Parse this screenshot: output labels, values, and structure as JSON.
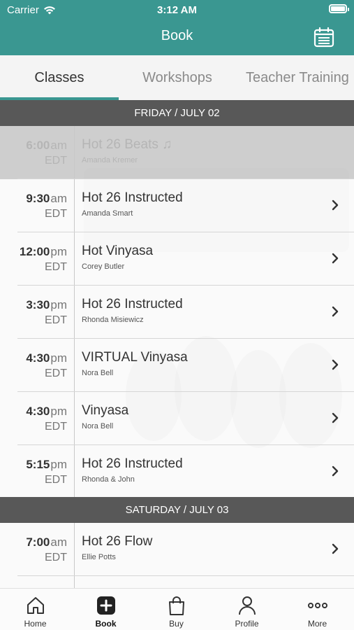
{
  "status_bar": {
    "carrier": "Carrier",
    "time": "3:12 AM"
  },
  "header": {
    "title": "Book",
    "icon": "calendar-icon"
  },
  "tabs": [
    {
      "label": "Classes",
      "active": true
    },
    {
      "label": "Workshops",
      "active": false
    },
    {
      "label": "Teacher Training",
      "active": false
    }
  ],
  "days": [
    {
      "label": "FRIDAY / JULY 02",
      "classes": [
        {
          "hour": "6:00",
          "ampm": "am",
          "tz": "EDT",
          "name": "Hot 26 Beats ♫",
          "teacher": "Amanda Kremer",
          "past": true
        },
        {
          "hour": "9:30",
          "ampm": "am",
          "tz": "EDT",
          "name": "Hot 26 Instructed",
          "teacher": "Amanda Smart",
          "past": false
        },
        {
          "hour": "12:00",
          "ampm": "pm",
          "tz": "EDT",
          "name": "Hot Vinyasa",
          "teacher": "Corey Butler",
          "past": false
        },
        {
          "hour": "3:30",
          "ampm": "pm",
          "tz": "EDT",
          "name": "Hot 26 Instructed",
          "teacher": "Rhonda Misiewicz",
          "past": false
        },
        {
          "hour": "4:30",
          "ampm": "pm",
          "tz": "EDT",
          "name": "VIRTUAL Vinyasa",
          "teacher": "Nora Bell",
          "past": false
        },
        {
          "hour": "4:30",
          "ampm": "pm",
          "tz": "EDT",
          "name": "Vinyasa",
          "teacher": "Nora Bell",
          "past": false
        },
        {
          "hour": "5:15",
          "ampm": "pm",
          "tz": "EDT",
          "name": "Hot 26 Instructed",
          "teacher": "Rhonda & John",
          "past": false
        }
      ]
    },
    {
      "label": "SATURDAY / JULY 03",
      "classes": [
        {
          "hour": "7:00",
          "ampm": "am",
          "tz": "EDT",
          "name": "Hot 26 Flow",
          "teacher": "Ellie Potts",
          "past": false
        }
      ]
    }
  ],
  "tabbar": [
    {
      "label": "Home",
      "icon": "home-icon",
      "active": false
    },
    {
      "label": "Book",
      "icon": "book-plus-icon",
      "active": true
    },
    {
      "label": "Buy",
      "icon": "shopping-bag-icon",
      "active": false
    },
    {
      "label": "Profile",
      "icon": "person-icon",
      "active": false
    },
    {
      "label": "More",
      "icon": "more-icon",
      "active": false
    }
  ],
  "colors": {
    "accent": "#3a9791",
    "day_header": "#585858"
  }
}
